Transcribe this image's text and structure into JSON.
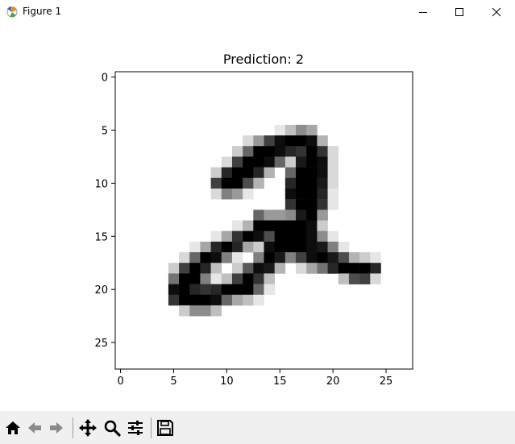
{
  "window": {
    "title": "Figure 1",
    "app_icon": "matplotlib-icon"
  },
  "window_controls": [
    "minimize-icon",
    "maximize-icon",
    "close-icon"
  ],
  "toolbar": {
    "buttons": [
      {
        "name": "home-button",
        "icon": "home-icon"
      },
      {
        "name": "back-button",
        "icon": "back-arrow-icon"
      },
      {
        "name": "forward-button",
        "icon": "forward-arrow-icon"
      },
      {
        "name": "pan-button",
        "icon": "move-arrows-icon"
      },
      {
        "name": "zoom-button",
        "icon": "magnifier-icon"
      },
      {
        "name": "configure-subplots-button",
        "icon": "sliders-icon"
      },
      {
        "name": "save-button",
        "icon": "floppy-disk-icon"
      }
    ]
  },
  "chart_data": {
    "type": "heatmap",
    "title": "Prediction: 2",
    "xlabel": "",
    "ylabel": "",
    "colormap": "gray_r",
    "grid": false,
    "xlim": [
      -0.5,
      27.5
    ],
    "ylim": [
      27.5,
      -0.5
    ],
    "x_ticks": [
      0,
      5,
      10,
      15,
      20,
      25
    ],
    "y_ticks": [
      0,
      5,
      10,
      15,
      20,
      25
    ],
    "x_tick_labels": [
      "0",
      "5",
      "10",
      "15",
      "20",
      "25"
    ],
    "y_tick_labels": [
      "0",
      "5",
      "10",
      "15",
      "20",
      "25"
    ],
    "pixels": [
      {
        "r": 5,
        "c": 15,
        "v": 0.1
      },
      {
        "r": 5,
        "c": 16,
        "v": 0.25
      },
      {
        "r": 5,
        "c": 17,
        "v": 0.45
      },
      {
        "r": 5,
        "c": 18,
        "v": 0.35
      },
      {
        "r": 6,
        "c": 12,
        "v": 0.15
      },
      {
        "r": 6,
        "c": 13,
        "v": 0.4
      },
      {
        "r": 6,
        "c": 14,
        "v": 0.75
      },
      {
        "r": 6,
        "c": 15,
        "v": 0.95
      },
      {
        "r": 6,
        "c": 16,
        "v": 1
      },
      {
        "r": 6,
        "c": 17,
        "v": 1
      },
      {
        "r": 6,
        "c": 18,
        "v": 0.95
      },
      {
        "r": 6,
        "c": 19,
        "v": 0.3
      },
      {
        "r": 7,
        "c": 11,
        "v": 0.2
      },
      {
        "r": 7,
        "c": 12,
        "v": 0.6
      },
      {
        "r": 7,
        "c": 13,
        "v": 1
      },
      {
        "r": 7,
        "c": 14,
        "v": 1
      },
      {
        "r": 7,
        "c": 15,
        "v": 0.95
      },
      {
        "r": 7,
        "c": 16,
        "v": 0.85
      },
      {
        "r": 7,
        "c": 17,
        "v": 0.8
      },
      {
        "r": 7,
        "c": 18,
        "v": 1
      },
      {
        "r": 7,
        "c": 19,
        "v": 0.8
      },
      {
        "r": 7,
        "c": 20,
        "v": 0.15
      },
      {
        "r": 8,
        "c": 10,
        "v": 0.15
      },
      {
        "r": 8,
        "c": 11,
        "v": 0.75
      },
      {
        "r": 8,
        "c": 12,
        "v": 1
      },
      {
        "r": 8,
        "c": 13,
        "v": 1
      },
      {
        "r": 8,
        "c": 14,
        "v": 0.95
      },
      {
        "r": 8,
        "c": 15,
        "v": 0.6
      },
      {
        "r": 8,
        "c": 16,
        "v": 0.2
      },
      {
        "r": 8,
        "c": 17,
        "v": 0.9
      },
      {
        "r": 8,
        "c": 18,
        "v": 1
      },
      {
        "r": 8,
        "c": 19,
        "v": 0.95
      },
      {
        "r": 8,
        "c": 20,
        "v": 0.15
      },
      {
        "r": 9,
        "c": 9,
        "v": 0.2
      },
      {
        "r": 9,
        "c": 10,
        "v": 0.85
      },
      {
        "r": 9,
        "c": 11,
        "v": 1
      },
      {
        "r": 9,
        "c": 12,
        "v": 1
      },
      {
        "r": 9,
        "c": 13,
        "v": 0.85
      },
      {
        "r": 9,
        "c": 14,
        "v": 0.3
      },
      {
        "r": 9,
        "c": 16,
        "v": 0.6
      },
      {
        "r": 9,
        "c": 17,
        "v": 1
      },
      {
        "r": 9,
        "c": 18,
        "v": 1
      },
      {
        "r": 9,
        "c": 19,
        "v": 0.95
      },
      {
        "r": 9,
        "c": 20,
        "v": 0.15
      },
      {
        "r": 10,
        "c": 9,
        "v": 0.75
      },
      {
        "r": 10,
        "c": 10,
        "v": 1
      },
      {
        "r": 10,
        "c": 11,
        "v": 1
      },
      {
        "r": 10,
        "c": 12,
        "v": 0.7
      },
      {
        "r": 10,
        "c": 13,
        "v": 0.3
      },
      {
        "r": 10,
        "c": 16,
        "v": 0.85
      },
      {
        "r": 10,
        "c": 17,
        "v": 1
      },
      {
        "r": 10,
        "c": 18,
        "v": 1
      },
      {
        "r": 10,
        "c": 19,
        "v": 0.9
      },
      {
        "r": 10,
        "c": 20,
        "v": 0.15
      },
      {
        "r": 11,
        "c": 9,
        "v": 0.15
      },
      {
        "r": 11,
        "c": 10,
        "v": 0.5
      },
      {
        "r": 11,
        "c": 11,
        "v": 0.4
      },
      {
        "r": 11,
        "c": 12,
        "v": 0.1
      },
      {
        "r": 11,
        "c": 16,
        "v": 0.95
      },
      {
        "r": 11,
        "c": 17,
        "v": 1
      },
      {
        "r": 11,
        "c": 18,
        "v": 1
      },
      {
        "r": 11,
        "c": 19,
        "v": 0.85
      },
      {
        "r": 11,
        "c": 20,
        "v": 0.1
      },
      {
        "r": 12,
        "c": 16,
        "v": 0.8
      },
      {
        "r": 12,
        "c": 17,
        "v": 1
      },
      {
        "r": 12,
        "c": 18,
        "v": 1
      },
      {
        "r": 12,
        "c": 19,
        "v": 0.8
      },
      {
        "r": 12,
        "c": 20,
        "v": 0.1
      },
      {
        "r": 13,
        "c": 13,
        "v": 0.6
      },
      {
        "r": 13,
        "c": 14,
        "v": 0.4
      },
      {
        "r": 13,
        "c": 15,
        "v": 0.4
      },
      {
        "r": 13,
        "c": 16,
        "v": 0.45
      },
      {
        "r": 13,
        "c": 17,
        "v": 0.9
      },
      {
        "r": 13,
        "c": 18,
        "v": 1
      },
      {
        "r": 13,
        "c": 19,
        "v": 0.4
      },
      {
        "r": 14,
        "c": 11,
        "v": 0.1
      },
      {
        "r": 14,
        "c": 12,
        "v": 0.3
      },
      {
        "r": 14,
        "c": 13,
        "v": 1
      },
      {
        "r": 14,
        "c": 14,
        "v": 1
      },
      {
        "r": 14,
        "c": 15,
        "v": 1
      },
      {
        "r": 14,
        "c": 16,
        "v": 1
      },
      {
        "r": 14,
        "c": 17,
        "v": 1
      },
      {
        "r": 14,
        "c": 18,
        "v": 0.95
      },
      {
        "r": 14,
        "c": 19,
        "v": 0.2
      },
      {
        "r": 15,
        "c": 9,
        "v": 0.1
      },
      {
        "r": 15,
        "c": 10,
        "v": 0.35
      },
      {
        "r": 15,
        "c": 11,
        "v": 0.8
      },
      {
        "r": 15,
        "c": 12,
        "v": 1
      },
      {
        "r": 15,
        "c": 13,
        "v": 0.95
      },
      {
        "r": 15,
        "c": 14,
        "v": 0.7
      },
      {
        "r": 15,
        "c": 15,
        "v": 1
      },
      {
        "r": 15,
        "c": 16,
        "v": 1
      },
      {
        "r": 15,
        "c": 17,
        "v": 1
      },
      {
        "r": 15,
        "c": 18,
        "v": 0.95
      },
      {
        "r": 15,
        "c": 19,
        "v": 0.45
      },
      {
        "r": 15,
        "c": 20,
        "v": 0.1
      },
      {
        "r": 16,
        "c": 7,
        "v": 0.1
      },
      {
        "r": 16,
        "c": 8,
        "v": 0.35
      },
      {
        "r": 16,
        "c": 9,
        "v": 0.85
      },
      {
        "r": 16,
        "c": 10,
        "v": 1
      },
      {
        "r": 16,
        "c": 11,
        "v": 0.85
      },
      {
        "r": 16,
        "c": 12,
        "v": 0.35
      },
      {
        "r": 16,
        "c": 13,
        "v": 0.2
      },
      {
        "r": 16,
        "c": 14,
        "v": 0.95
      },
      {
        "r": 16,
        "c": 15,
        "v": 1
      },
      {
        "r": 16,
        "c": 16,
        "v": 1
      },
      {
        "r": 16,
        "c": 17,
        "v": 1
      },
      {
        "r": 16,
        "c": 18,
        "v": 0.95
      },
      {
        "r": 16,
        "c": 19,
        "v": 0.9
      },
      {
        "r": 16,
        "c": 20,
        "v": 0.5
      },
      {
        "r": 16,
        "c": 21,
        "v": 0.1
      },
      {
        "r": 17,
        "c": 6,
        "v": 0.15
      },
      {
        "r": 17,
        "c": 7,
        "v": 0.6
      },
      {
        "r": 17,
        "c": 8,
        "v": 1
      },
      {
        "r": 17,
        "c": 9,
        "v": 0.95
      },
      {
        "r": 17,
        "c": 10,
        "v": 0.5
      },
      {
        "r": 17,
        "c": 11,
        "v": 0.1
      },
      {
        "r": 17,
        "c": 13,
        "v": 0.5
      },
      {
        "r": 17,
        "c": 14,
        "v": 1
      },
      {
        "r": 17,
        "c": 15,
        "v": 0.9
      },
      {
        "r": 17,
        "c": 16,
        "v": 0.5
      },
      {
        "r": 17,
        "c": 17,
        "v": 0.75
      },
      {
        "r": 17,
        "c": 18,
        "v": 0.95
      },
      {
        "r": 17,
        "c": 19,
        "v": 1
      },
      {
        "r": 17,
        "c": 20,
        "v": 0.9
      },
      {
        "r": 17,
        "c": 21,
        "v": 0.7
      },
      {
        "r": 17,
        "c": 22,
        "v": 0.3
      },
      {
        "r": 17,
        "c": 23,
        "v": 0.2
      },
      {
        "r": 17,
        "c": 24,
        "v": 0.1
      },
      {
        "r": 18,
        "c": 5,
        "v": 0.2
      },
      {
        "r": 18,
        "c": 6,
        "v": 0.75
      },
      {
        "r": 18,
        "c": 7,
        "v": 1
      },
      {
        "r": 18,
        "c": 8,
        "v": 0.85
      },
      {
        "r": 18,
        "c": 9,
        "v": 0.25
      },
      {
        "r": 18,
        "c": 11,
        "v": 0.2
      },
      {
        "r": 18,
        "c": 12,
        "v": 0.65
      },
      {
        "r": 18,
        "c": 13,
        "v": 0.95
      },
      {
        "r": 18,
        "c": 14,
        "v": 0.9
      },
      {
        "r": 18,
        "c": 15,
        "v": 0.3
      },
      {
        "r": 18,
        "c": 17,
        "v": 0.15
      },
      {
        "r": 18,
        "c": 18,
        "v": 0.35
      },
      {
        "r": 18,
        "c": 19,
        "v": 0.55
      },
      {
        "r": 18,
        "c": 20,
        "v": 0.85
      },
      {
        "r": 18,
        "c": 21,
        "v": 1
      },
      {
        "r": 18,
        "c": 22,
        "v": 1
      },
      {
        "r": 18,
        "c": 23,
        "v": 1
      },
      {
        "r": 18,
        "c": 24,
        "v": 0.85
      },
      {
        "r": 19,
        "c": 5,
        "v": 0.55
      },
      {
        "r": 19,
        "c": 6,
        "v": 1
      },
      {
        "r": 19,
        "c": 7,
        "v": 1
      },
      {
        "r": 19,
        "c": 8,
        "v": 0.5
      },
      {
        "r": 19,
        "c": 9,
        "v": 0.1
      },
      {
        "r": 19,
        "c": 10,
        "v": 0.25
      },
      {
        "r": 19,
        "c": 11,
        "v": 0.75
      },
      {
        "r": 19,
        "c": 12,
        "v": 1
      },
      {
        "r": 19,
        "c": 13,
        "v": 0.8
      },
      {
        "r": 19,
        "c": 14,
        "v": 0.25
      },
      {
        "r": 19,
        "c": 21,
        "v": 0.25
      },
      {
        "r": 19,
        "c": 22,
        "v": 0.7
      },
      {
        "r": 19,
        "c": 23,
        "v": 0.75
      },
      {
        "r": 19,
        "c": 24,
        "v": 0.15
      },
      {
        "r": 20,
        "c": 5,
        "v": 0.95
      },
      {
        "r": 20,
        "c": 6,
        "v": 1
      },
      {
        "r": 20,
        "c": 7,
        "v": 0.85
      },
      {
        "r": 20,
        "c": 8,
        "v": 0.8
      },
      {
        "r": 20,
        "c": 9,
        "v": 0.85
      },
      {
        "r": 20,
        "c": 10,
        "v": 1
      },
      {
        "r": 20,
        "c": 11,
        "v": 1
      },
      {
        "r": 20,
        "c": 12,
        "v": 1
      },
      {
        "r": 20,
        "c": 13,
        "v": 0.6
      },
      {
        "r": 20,
        "c": 14,
        "v": 0.1
      },
      {
        "r": 21,
        "c": 5,
        "v": 0.8
      },
      {
        "r": 21,
        "c": 6,
        "v": 1
      },
      {
        "r": 21,
        "c": 7,
        "v": 1
      },
      {
        "r": 21,
        "c": 8,
        "v": 1
      },
      {
        "r": 21,
        "c": 9,
        "v": 0.95
      },
      {
        "r": 21,
        "c": 10,
        "v": 0.6
      },
      {
        "r": 21,
        "c": 11,
        "v": 0.35
      },
      {
        "r": 21,
        "c": 12,
        "v": 0.25
      },
      {
        "r": 21,
        "c": 13,
        "v": 0.1
      },
      {
        "r": 22,
        "c": 6,
        "v": 0.2
      },
      {
        "r": 22,
        "c": 7,
        "v": 0.45
      },
      {
        "r": 22,
        "c": 8,
        "v": 0.45
      },
      {
        "r": 22,
        "c": 9,
        "v": 0.25
      }
    ]
  }
}
